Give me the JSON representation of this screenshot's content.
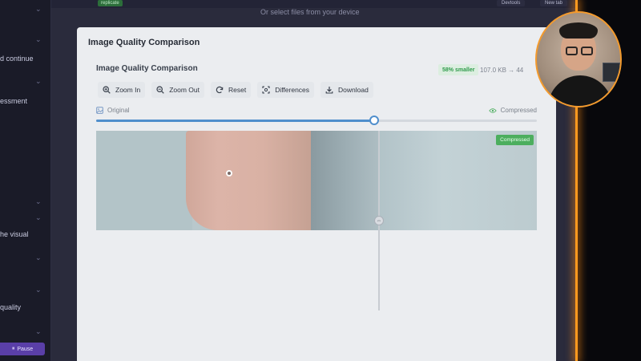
{
  "background": {
    "sidebar_items": [
      {
        "label": "d continue"
      },
      {
        "label": "essment"
      },
      {
        "label": "he visual"
      },
      {
        "label": "quality"
      }
    ],
    "pause_label": "Pause",
    "topbar": {
      "tag": "replicate",
      "devtools_label": "Devtools",
      "new_tab_label": "New tab"
    },
    "hint_text": "Or select files from your device"
  },
  "modal": {
    "title": "Image Quality Comparison",
    "comparison": {
      "title": "Image Quality Comparison",
      "savings_badge": "58% smaller",
      "size_text": "107.0 KB → 44"
    },
    "toolbar": {
      "zoom_in": "Zoom In",
      "zoom_out": "Zoom Out",
      "reset": "Reset",
      "differences": "Differences",
      "download": "Download"
    },
    "labels": {
      "original": "Original",
      "compressed": "Compressed"
    },
    "slider": {
      "value_percent": 63
    },
    "image_badge": "Compressed"
  },
  "colors": {
    "accent": "#4f8ecc",
    "success": "#4cae5e",
    "orange_glow": "#ff9a1f"
  }
}
